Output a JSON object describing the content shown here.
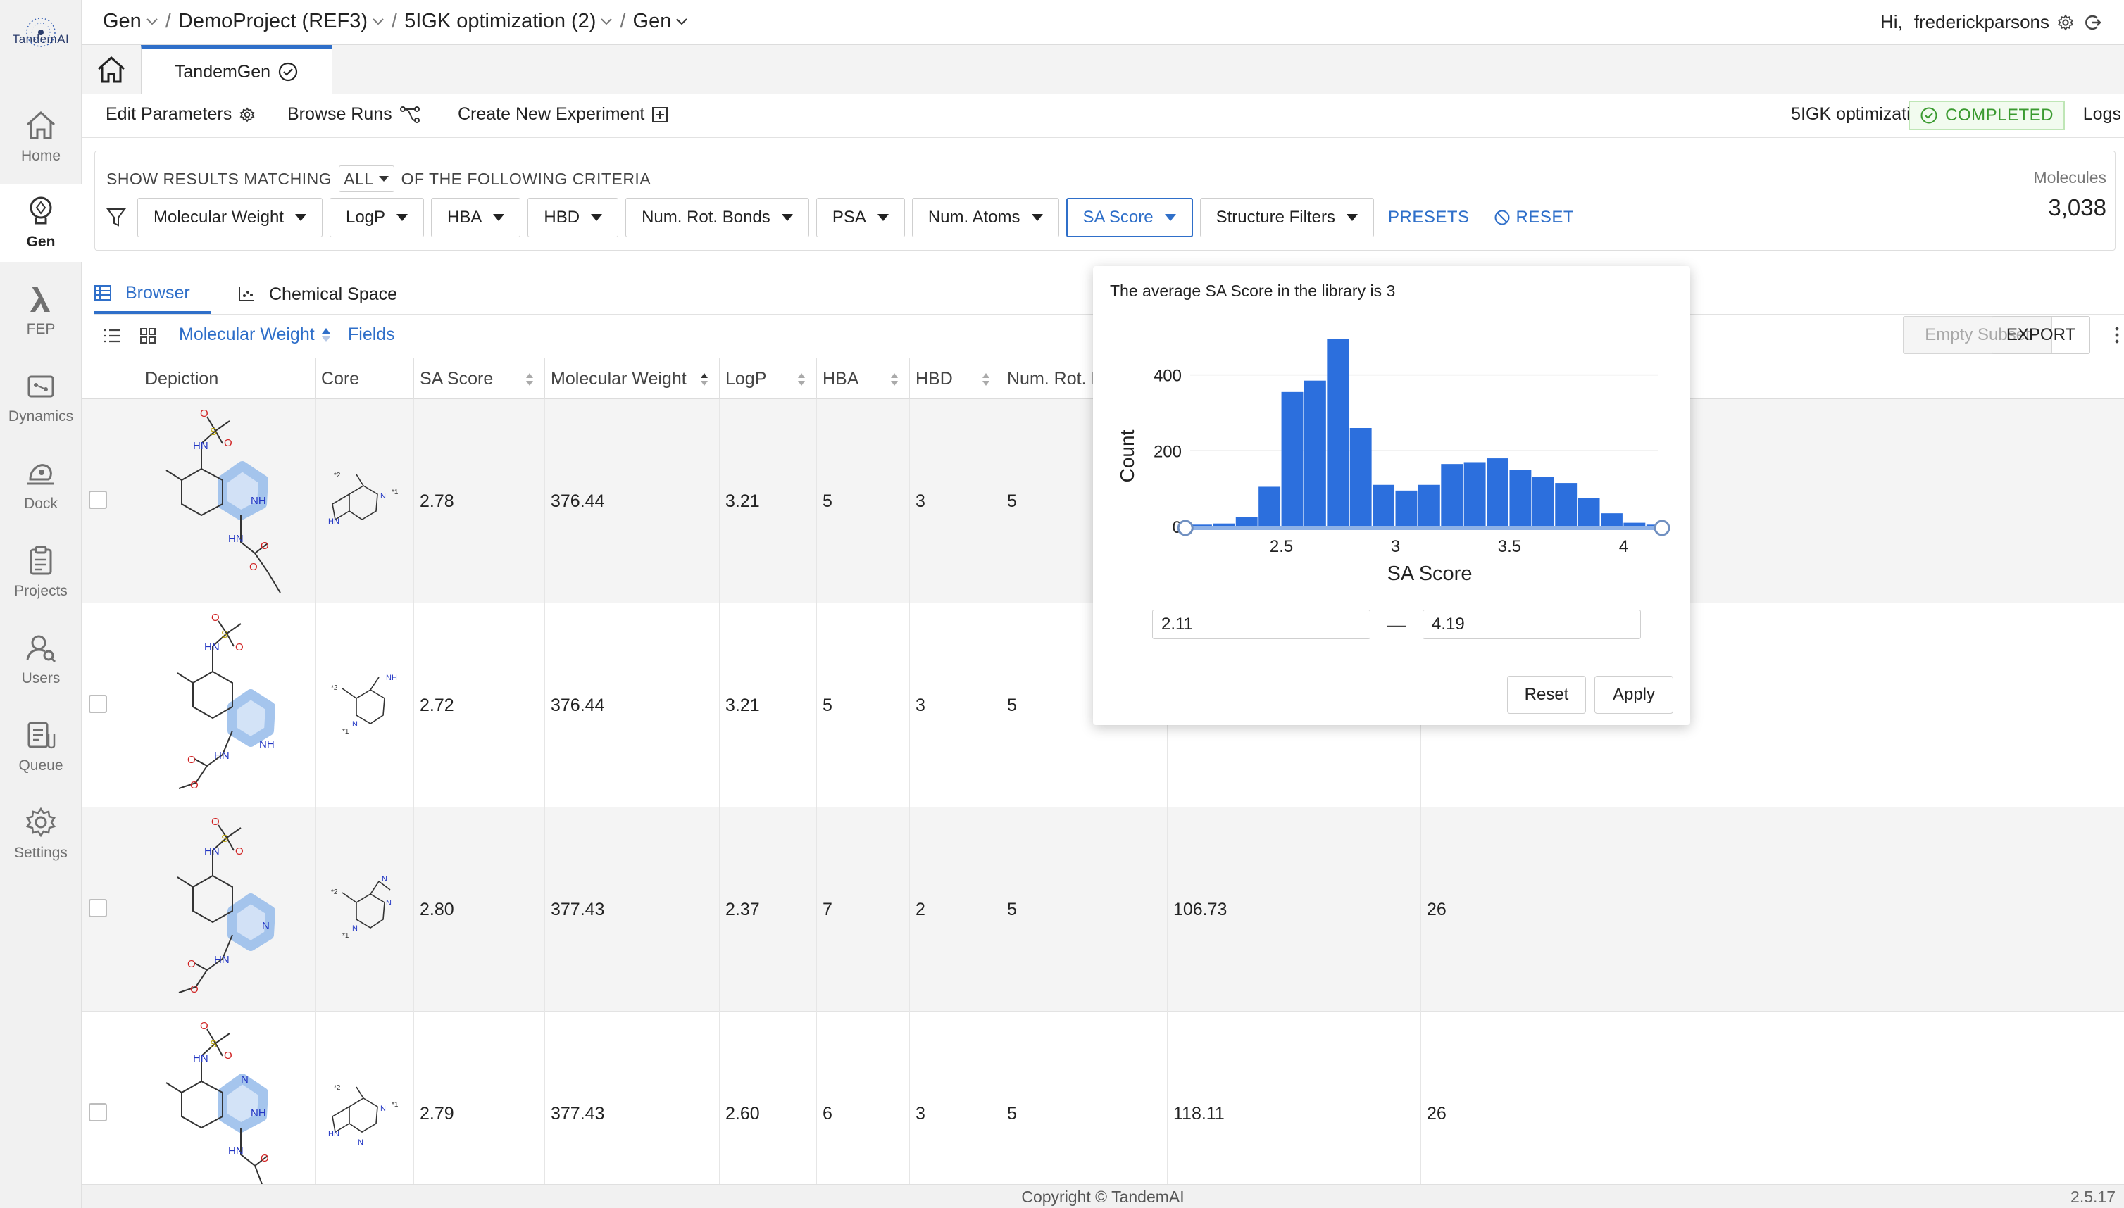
{
  "app": {
    "logo_text": "TandemAI"
  },
  "sidebar": {
    "items": [
      {
        "label": "Home",
        "icon": "home-icon"
      },
      {
        "label": "Gen",
        "icon": "gen-icon"
      },
      {
        "label": "FEP",
        "icon": "lambda-icon"
      },
      {
        "label": "Dynamics",
        "icon": "dynamics-icon"
      },
      {
        "label": "Dock",
        "icon": "dock-icon"
      },
      {
        "label": "Projects",
        "icon": "clipboard-icon"
      },
      {
        "label": "Users",
        "icon": "users-icon"
      },
      {
        "label": "Queue",
        "icon": "queue-icon"
      },
      {
        "label": "Settings",
        "icon": "gear-icon"
      }
    ]
  },
  "breadcrumb": {
    "module": "Gen",
    "project": "DemoProject (REF3)",
    "run": "5IGK optimization (2)",
    "tool": "Gen"
  },
  "user": {
    "greeting": "Hi,",
    "name": "frederickparsons"
  },
  "tabs": {
    "active": "TandemGen"
  },
  "actions": {
    "edit_parameters": "Edit Parameters",
    "browse_runs": "Browse Runs",
    "create_experiment": "Create New Experiment",
    "run_name": "5IGK optimization (2)",
    "status": "COMPLETED",
    "logs": "Logs"
  },
  "filters": {
    "prefix": "SHOW RESULTS MATCHING",
    "match": "ALL",
    "suffix": "OF THE FOLLOWING CRITERIA",
    "items": [
      "Molecular Weight",
      "LogP",
      "HBA",
      "HBD",
      "Num. Rot. Bonds",
      "PSA",
      "Num. Atoms",
      "SA Score",
      "Structure Filters"
    ],
    "active_filter": "SA Score",
    "presets": "PRESETS",
    "reset": "RESET",
    "molecules_label": "Molecules",
    "molecules_count": "3,038"
  },
  "view_tabs": {
    "browser": "Browser",
    "chemical_space": "Chemical Space"
  },
  "table_toolbar": {
    "sort_field": "Molecular Weight",
    "fields": "Fields",
    "empty_subset": "Empty Subset",
    "export": "EXPORT"
  },
  "table": {
    "columns": [
      "Depiction",
      "Core",
      "SA Score",
      "Molecular Weight",
      "LogP",
      "HBA",
      "HBD",
      "Num. Rot. B"
    ],
    "rows": [
      {
        "sa": "2.78",
        "mw": "376.44",
        "logp": "3.21",
        "hba": "5",
        "hbd": "3",
        "rot": "5",
        "psa": "",
        "atoms": ""
      },
      {
        "sa": "2.72",
        "mw": "376.44",
        "logp": "3.21",
        "hba": "5",
        "hbd": "3",
        "rot": "5",
        "psa": "",
        "atoms": ""
      },
      {
        "sa": "2.80",
        "mw": "377.43",
        "logp": "2.37",
        "hba": "7",
        "hbd": "2",
        "rot": "5",
        "psa": "106.73",
        "atoms": "26"
      },
      {
        "sa": "2.79",
        "mw": "377.43",
        "logp": "2.60",
        "hba": "6",
        "hbd": "3",
        "rot": "5",
        "psa": "118.11",
        "atoms": "26"
      }
    ]
  },
  "popover": {
    "title": "The average SA Score in the library is 3",
    "range_min": "2.11",
    "range_max": "4.19",
    "reset": "Reset",
    "apply": "Apply"
  },
  "chart_data": {
    "type": "bar",
    "title": "",
    "xlabel": "SA Score",
    "ylabel": "Count",
    "bin_start": 2.1,
    "bin_width": 0.1,
    "values": [
      5,
      8,
      25,
      105,
      355,
      385,
      495,
      260,
      110,
      95,
      110,
      165,
      170,
      180,
      150,
      130,
      115,
      75,
      35,
      10,
      5
    ],
    "xticks": [
      2.5,
      3,
      3.5,
      4
    ],
    "yticks": [
      0,
      200,
      400
    ],
    "xlim": [
      2.1,
      4.15
    ],
    "ylim": [
      0,
      520
    ],
    "selection": [
      2.11,
      4.19
    ],
    "color": "#2c6fdd"
  },
  "footer": {
    "copyright": "Copyright © TandemAI",
    "version": "2.5.17"
  }
}
